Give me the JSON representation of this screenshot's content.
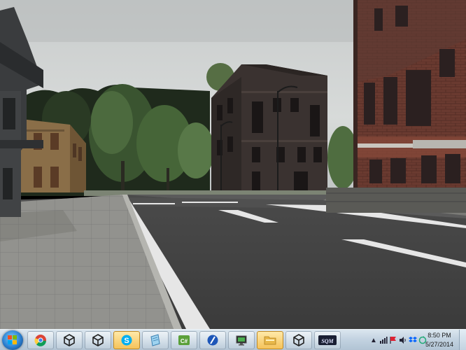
{
  "taskbar": {
    "apps": [
      {
        "name": "Google Chrome",
        "icon": "chrome-icon"
      },
      {
        "name": "Unity",
        "icon": "unity-icon"
      },
      {
        "name": "Unity",
        "icon": "unity-icon"
      },
      {
        "name": "Skype",
        "icon": "skype-icon"
      },
      {
        "name": "Notes",
        "icon": "notes-icon"
      },
      {
        "name": "C#",
        "icon": "csharp-icon"
      },
      {
        "name": "Dev Tool",
        "icon": "blue-circle-icon"
      },
      {
        "name": "Unity",
        "icon": "unity-icon"
      },
      {
        "name": "Monitor",
        "icon": "monitor-icon"
      },
      {
        "name": "Folder",
        "icon": "folder-icon"
      },
      {
        "name": "Unity",
        "icon": "unity-icon"
      },
      {
        "name": "SQM",
        "icon": "sqm-icon"
      }
    ],
    "sqm_label": "SQM",
    "csharp_label": "C#",
    "clock": {
      "time": "8:50 PM",
      "date": "5/27/2014"
    }
  }
}
